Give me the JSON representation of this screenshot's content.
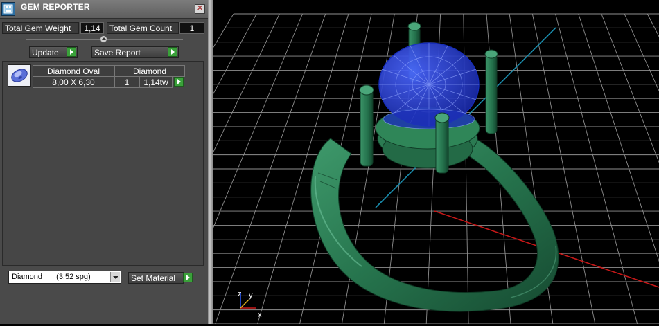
{
  "window": {
    "title": "GEM REPORTER",
    "close_glyph": "✕"
  },
  "summary": {
    "weight_label": "Total Gem Weight",
    "weight_value": "1,14",
    "count_label": "Total Gem Count",
    "count_value": "1"
  },
  "actions": {
    "update_label": "Update",
    "save_label": "Save Report"
  },
  "report": {
    "rows": [
      {
        "shape": "Diamond Oval",
        "size": "8,00 X 6,30",
        "material": "Diamond",
        "count": "1",
        "weight": "1,14tw"
      }
    ]
  },
  "material_picker": {
    "selected_name": "Diamond",
    "selected_density": "(3,52 spg)",
    "set_label": "Set Material"
  },
  "axis_gizmo": {
    "z": "z",
    "y": "y",
    "x": "x"
  },
  "colors": {
    "panel_bg": "#4a4a4a",
    "accent_green": "#3aa13a",
    "ring_green": "#2a7d55",
    "gem_blue": "#2a3fe0",
    "axis_red": "#c81818",
    "axis_blue": "#1a8fb0",
    "grid": "#a8a8a8"
  },
  "icons": [
    "app-icon",
    "close-icon",
    "collapse-icon",
    "play-icon",
    "gem-thumbnail",
    "dropdown-arrow-icon"
  ]
}
